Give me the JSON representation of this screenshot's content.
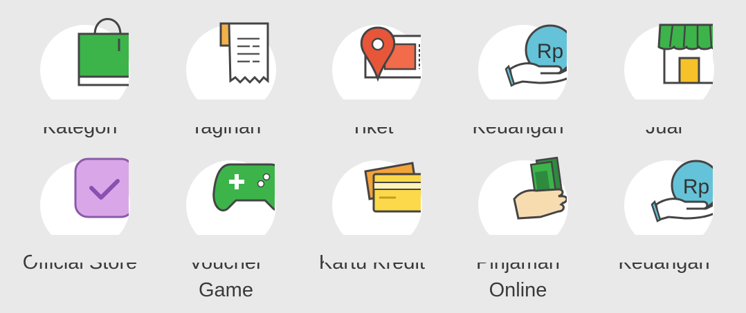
{
  "menu": {
    "items": [
      {
        "label": "Kategori",
        "icon": "shopping-bag-icon"
      },
      {
        "label": "Tagihan",
        "icon": "receipt-icon"
      },
      {
        "label": "Tiket",
        "icon": "ticket-icon"
      },
      {
        "label": "Keuangan",
        "icon": "rupiah-hand-icon"
      },
      {
        "label": "Jual",
        "icon": "store-icon"
      },
      {
        "label": "Official Store",
        "icon": "official-check-icon"
      },
      {
        "label": "Voucher\nGame",
        "icon": "gamepad-icon"
      },
      {
        "label": "Kartu Kredit",
        "icon": "credit-card-icon"
      },
      {
        "label": "Pinjaman\nOnline",
        "icon": "cash-hand-icon"
      },
      {
        "label": "Keuangan",
        "icon": "rupiah-hand-icon"
      }
    ]
  },
  "colors": {
    "background": "#e9e9e9",
    "green": "#3cb44a",
    "orange": "#e8563a",
    "teal": "#64c3d8",
    "purple": "#d9a6e8",
    "yellow": "#f6d23a"
  }
}
